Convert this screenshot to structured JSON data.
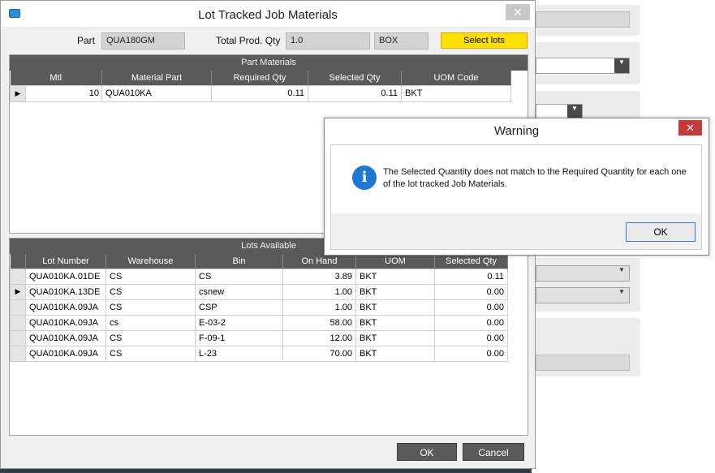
{
  "window": {
    "title": "Lot Tracked Job Materials",
    "close_glyph": "✕"
  },
  "header": {
    "part_label": "Part",
    "part_value": "QUA180GM",
    "total_qty_label": "Total Prod. Qty",
    "total_qty_value": "1.0",
    "uom_value": "BOX",
    "select_lots_label": "Select lots",
    "select_lots_color": "#ffe100"
  },
  "part_materials": {
    "caption": "Part Materials",
    "columns": [
      "Mtl",
      "Material Part",
      "Required Qty",
      "Selected Qty",
      "UOM Code"
    ],
    "rows": [
      {
        "indicator": "▶",
        "mtl": "10",
        "material_part": "QUA010KA",
        "required_qty": "0.11",
        "selected_qty": "0.11",
        "uom": "BKT"
      }
    ]
  },
  "lots_available": {
    "caption": "Lots Available",
    "columns": [
      "Lot Number",
      "Warehouse",
      "Bin",
      "On Hand",
      "UOM",
      "Selected Qty"
    ],
    "rows": [
      {
        "indicator": "",
        "lot": "QUA010KA.01DE",
        "warehouse": "CS",
        "bin": "CS",
        "on_hand": "3.89",
        "uom": "BKT",
        "selected_qty": "0.11"
      },
      {
        "indicator": "▶",
        "lot": "QUA010KA.13DE",
        "warehouse": "CS",
        "bin": "csnew",
        "on_hand": "1.00",
        "uom": "BKT",
        "selected_qty": "0.00"
      },
      {
        "indicator": "",
        "lot": "QUA010KA.09JA",
        "warehouse": "CS",
        "bin": "CSP",
        "on_hand": "1.00",
        "uom": "BKT",
        "selected_qty": "0.00"
      },
      {
        "indicator": "",
        "lot": "QUA010KA.09JA",
        "warehouse": "cs",
        "bin": "E-03-2",
        "on_hand": "58.00",
        "uom": "BKT",
        "selected_qty": "0.00"
      },
      {
        "indicator": "",
        "lot": "QUA010KA.09JA",
        "warehouse": "CS",
        "bin": "F-09-1",
        "on_hand": "12.00",
        "uom": "BKT",
        "selected_qty": "0.00"
      },
      {
        "indicator": "",
        "lot": "QUA010KA.09JA",
        "warehouse": "CS",
        "bin": "L-23",
        "on_hand": "70.00",
        "uom": "BKT",
        "selected_qty": "0.00"
      }
    ]
  },
  "footer": {
    "ok_label": "OK",
    "cancel_label": "Cancel"
  },
  "warning": {
    "title": "Warning",
    "close_glyph": "✕",
    "icon": "info-icon",
    "icon_glyph": "i",
    "message": "The Selected Quantity does not match to the Required Quantity for each one of the lot tracked Job Materials.",
    "ok_label": "OK",
    "accent_color": "#1e78d2",
    "close_color": "#c63a3a"
  }
}
